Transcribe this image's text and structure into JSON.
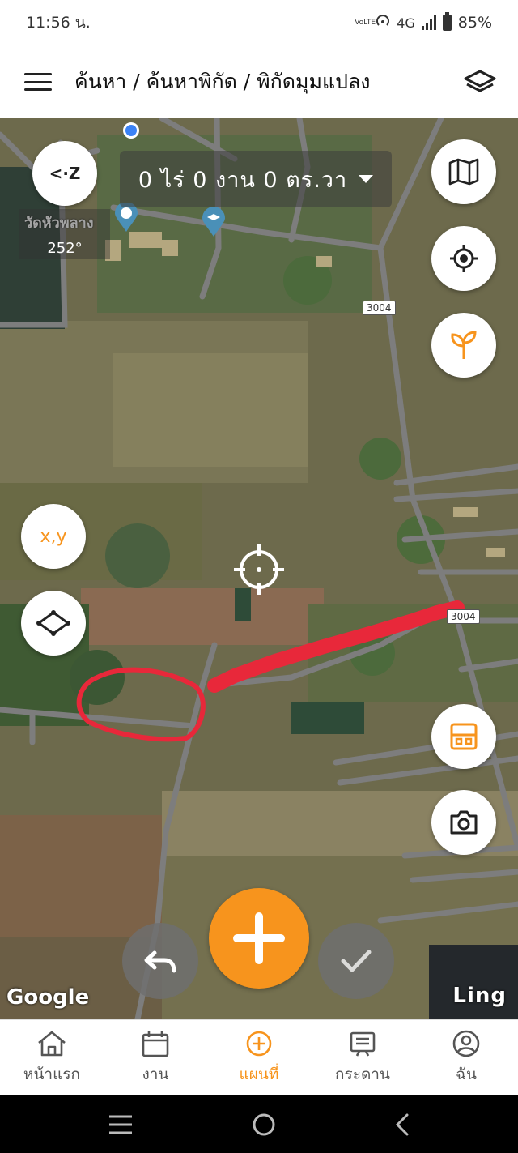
{
  "status_bar": {
    "time": "11:56 น.",
    "network": "4G",
    "battery": "85%",
    "volte": "VoLTE"
  },
  "header": {
    "breadcrumb": "ค้นหา / ค้นหาพิกัด / พิกัดมุมแปลง"
  },
  "map": {
    "area_readout": "0 ไร่ 0 งาน 0 ตร.วา",
    "compass_button": "<·Z",
    "place_name": "วัดหัวพลาง",
    "heading": "252°",
    "road_number_top": "3004",
    "road_number_right": "3004",
    "xy_button": "x,y",
    "google_attribution": "Google",
    "ling_attribution": "Ling"
  },
  "bottom_nav": [
    {
      "label": "หน้าแรก",
      "icon": "home-icon"
    },
    {
      "label": "งาน",
      "icon": "calendar-icon"
    },
    {
      "label": "แผนที่",
      "icon": "add-circle-icon",
      "active": true
    },
    {
      "label": "กระดาน",
      "icon": "board-icon"
    },
    {
      "label": "ฉัน",
      "icon": "user-icon"
    }
  ],
  "colors": {
    "accent": "#f7941d",
    "annotation": "#e8283a",
    "road": "#7b7b7b"
  }
}
